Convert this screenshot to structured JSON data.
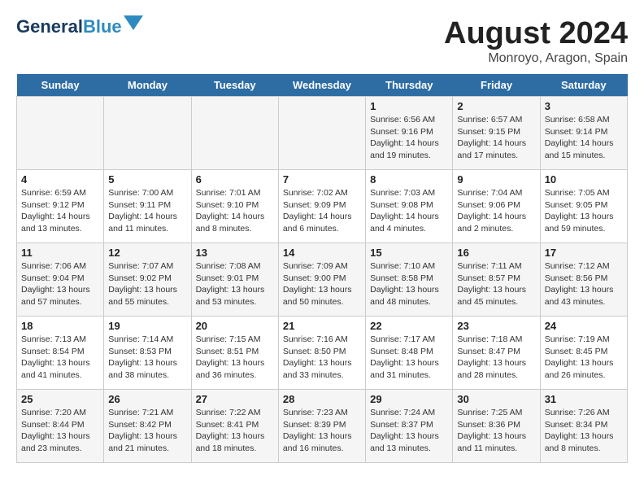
{
  "header": {
    "logo_line1": "General",
    "logo_line2": "Blue",
    "title": "August 2024",
    "subtitle": "Monroyo, Aragon, Spain"
  },
  "days_of_week": [
    "Sunday",
    "Monday",
    "Tuesday",
    "Wednesday",
    "Thursday",
    "Friday",
    "Saturday"
  ],
  "weeks": [
    [
      {
        "day": "",
        "info": ""
      },
      {
        "day": "",
        "info": ""
      },
      {
        "day": "",
        "info": ""
      },
      {
        "day": "",
        "info": ""
      },
      {
        "day": "1",
        "info": "Sunrise: 6:56 AM\nSunset: 9:16 PM\nDaylight: 14 hours\nand 19 minutes."
      },
      {
        "day": "2",
        "info": "Sunrise: 6:57 AM\nSunset: 9:15 PM\nDaylight: 14 hours\nand 17 minutes."
      },
      {
        "day": "3",
        "info": "Sunrise: 6:58 AM\nSunset: 9:14 PM\nDaylight: 14 hours\nand 15 minutes."
      }
    ],
    [
      {
        "day": "4",
        "info": "Sunrise: 6:59 AM\nSunset: 9:12 PM\nDaylight: 14 hours\nand 13 minutes."
      },
      {
        "day": "5",
        "info": "Sunrise: 7:00 AM\nSunset: 9:11 PM\nDaylight: 14 hours\nand 11 minutes."
      },
      {
        "day": "6",
        "info": "Sunrise: 7:01 AM\nSunset: 9:10 PM\nDaylight: 14 hours\nand 8 minutes."
      },
      {
        "day": "7",
        "info": "Sunrise: 7:02 AM\nSunset: 9:09 PM\nDaylight: 14 hours\nand 6 minutes."
      },
      {
        "day": "8",
        "info": "Sunrise: 7:03 AM\nSunset: 9:08 PM\nDaylight: 14 hours\nand 4 minutes."
      },
      {
        "day": "9",
        "info": "Sunrise: 7:04 AM\nSunset: 9:06 PM\nDaylight: 14 hours\nand 2 minutes."
      },
      {
        "day": "10",
        "info": "Sunrise: 7:05 AM\nSunset: 9:05 PM\nDaylight: 13 hours\nand 59 minutes."
      }
    ],
    [
      {
        "day": "11",
        "info": "Sunrise: 7:06 AM\nSunset: 9:04 PM\nDaylight: 13 hours\nand 57 minutes."
      },
      {
        "day": "12",
        "info": "Sunrise: 7:07 AM\nSunset: 9:02 PM\nDaylight: 13 hours\nand 55 minutes."
      },
      {
        "day": "13",
        "info": "Sunrise: 7:08 AM\nSunset: 9:01 PM\nDaylight: 13 hours\nand 53 minutes."
      },
      {
        "day": "14",
        "info": "Sunrise: 7:09 AM\nSunset: 9:00 PM\nDaylight: 13 hours\nand 50 minutes."
      },
      {
        "day": "15",
        "info": "Sunrise: 7:10 AM\nSunset: 8:58 PM\nDaylight: 13 hours\nand 48 minutes."
      },
      {
        "day": "16",
        "info": "Sunrise: 7:11 AM\nSunset: 8:57 PM\nDaylight: 13 hours\nand 45 minutes."
      },
      {
        "day": "17",
        "info": "Sunrise: 7:12 AM\nSunset: 8:56 PM\nDaylight: 13 hours\nand 43 minutes."
      }
    ],
    [
      {
        "day": "18",
        "info": "Sunrise: 7:13 AM\nSunset: 8:54 PM\nDaylight: 13 hours\nand 41 minutes."
      },
      {
        "day": "19",
        "info": "Sunrise: 7:14 AM\nSunset: 8:53 PM\nDaylight: 13 hours\nand 38 minutes."
      },
      {
        "day": "20",
        "info": "Sunrise: 7:15 AM\nSunset: 8:51 PM\nDaylight: 13 hours\nand 36 minutes."
      },
      {
        "day": "21",
        "info": "Sunrise: 7:16 AM\nSunset: 8:50 PM\nDaylight: 13 hours\nand 33 minutes."
      },
      {
        "day": "22",
        "info": "Sunrise: 7:17 AM\nSunset: 8:48 PM\nDaylight: 13 hours\nand 31 minutes."
      },
      {
        "day": "23",
        "info": "Sunrise: 7:18 AM\nSunset: 8:47 PM\nDaylight: 13 hours\nand 28 minutes."
      },
      {
        "day": "24",
        "info": "Sunrise: 7:19 AM\nSunset: 8:45 PM\nDaylight: 13 hours\nand 26 minutes."
      }
    ],
    [
      {
        "day": "25",
        "info": "Sunrise: 7:20 AM\nSunset: 8:44 PM\nDaylight: 13 hours\nand 23 minutes."
      },
      {
        "day": "26",
        "info": "Sunrise: 7:21 AM\nSunset: 8:42 PM\nDaylight: 13 hours\nand 21 minutes."
      },
      {
        "day": "27",
        "info": "Sunrise: 7:22 AM\nSunset: 8:41 PM\nDaylight: 13 hours\nand 18 minutes."
      },
      {
        "day": "28",
        "info": "Sunrise: 7:23 AM\nSunset: 8:39 PM\nDaylight: 13 hours\nand 16 minutes."
      },
      {
        "day": "29",
        "info": "Sunrise: 7:24 AM\nSunset: 8:37 PM\nDaylight: 13 hours\nand 13 minutes."
      },
      {
        "day": "30",
        "info": "Sunrise: 7:25 AM\nSunset: 8:36 PM\nDaylight: 13 hours\nand 11 minutes."
      },
      {
        "day": "31",
        "info": "Sunrise: 7:26 AM\nSunset: 8:34 PM\nDaylight: 13 hours\nand 8 minutes."
      }
    ]
  ]
}
